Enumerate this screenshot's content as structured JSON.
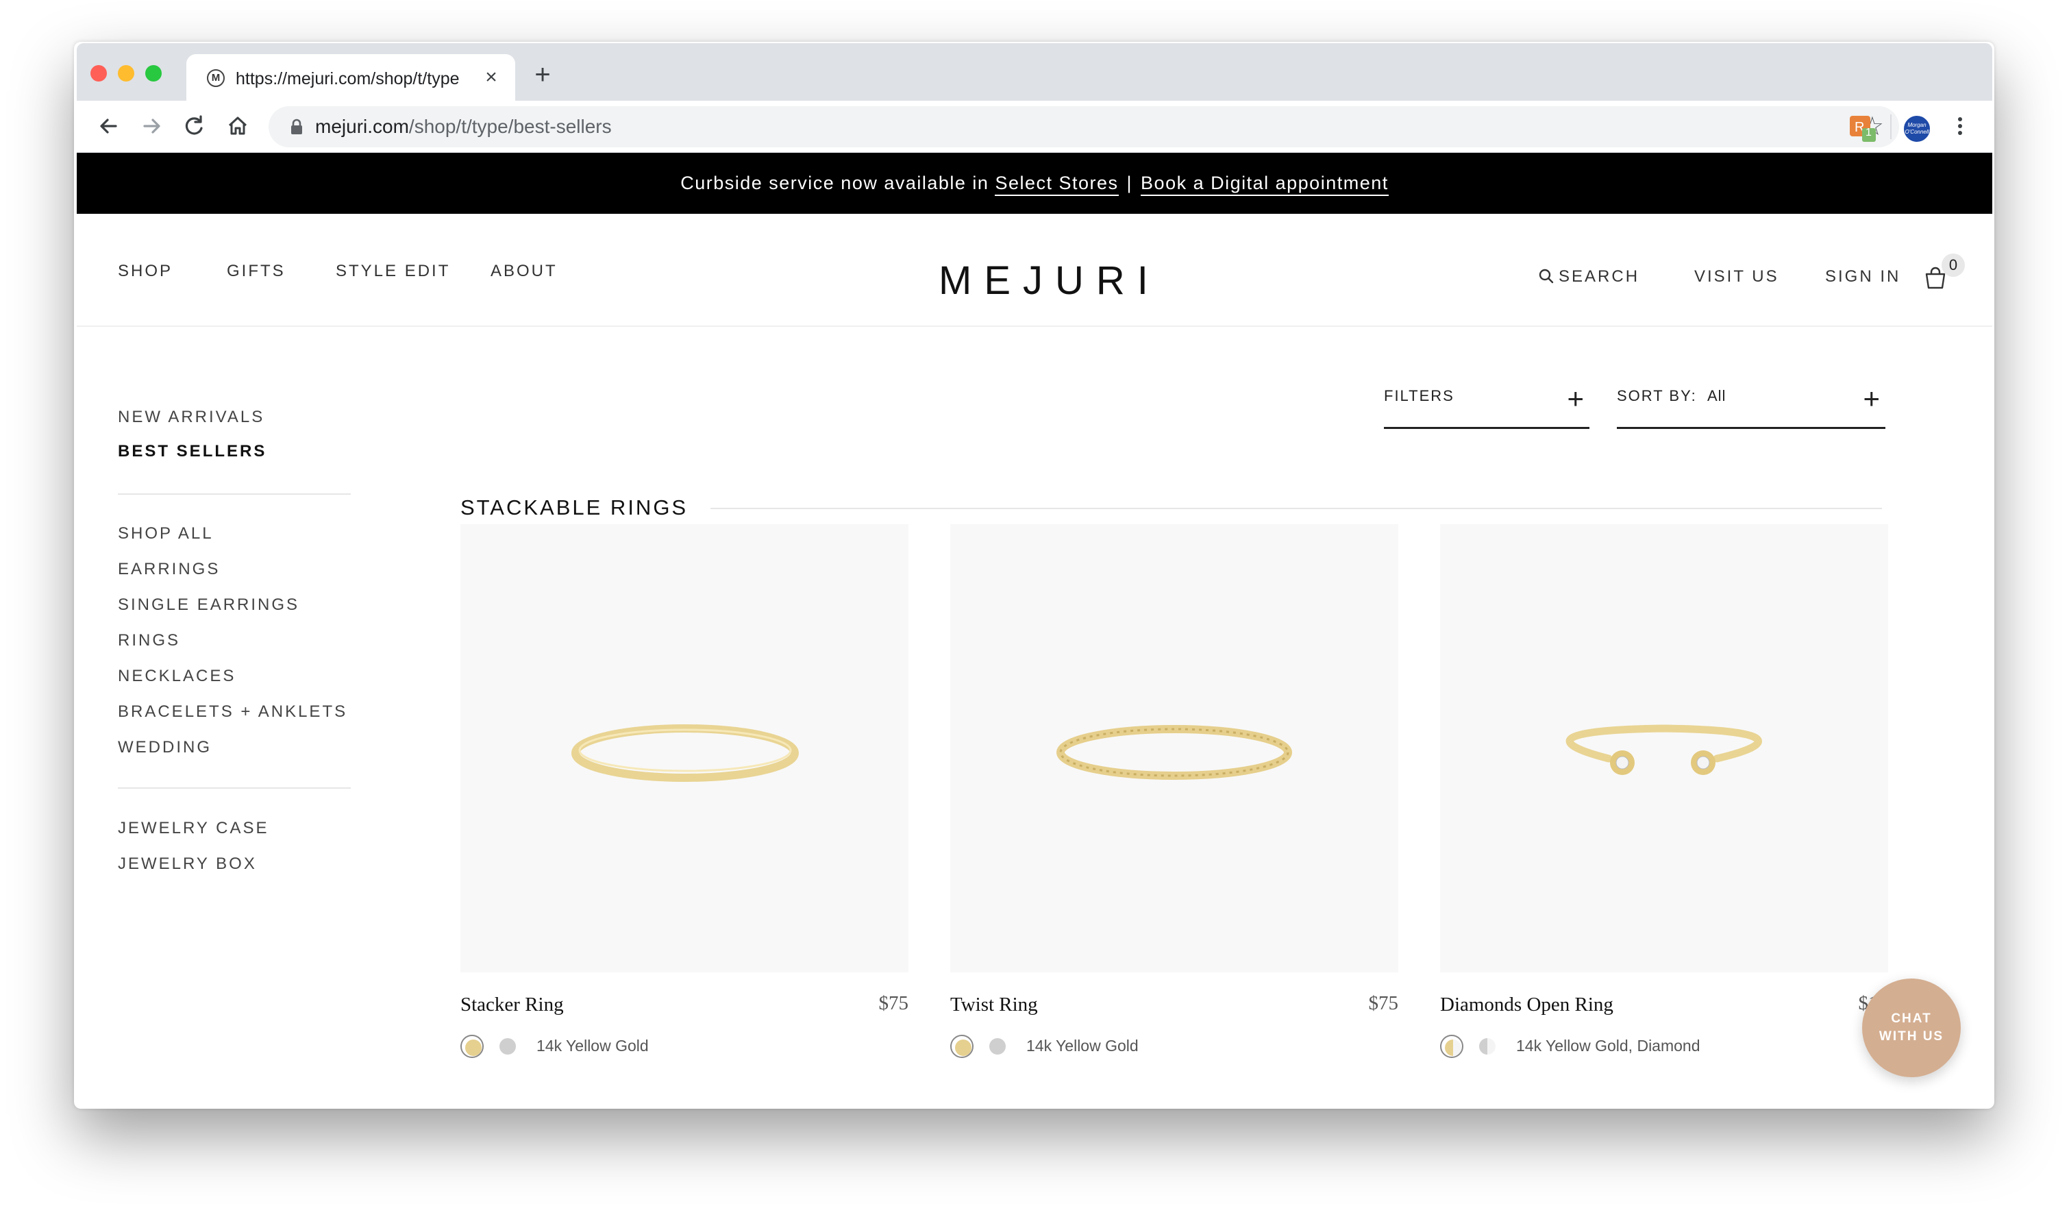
{
  "browser": {
    "tab_title": "https://mejuri.com/shop/t/type",
    "favicon_letter": "M",
    "url_host": "mejuri.com",
    "url_path": "/shop/t/type/best-sellers",
    "extension_badge": "1",
    "profile_label": "Morgan O'Connell"
  },
  "promo": {
    "text": "Curbside service now available in",
    "link1": "Select Stores",
    "separator": "|",
    "link2": "Book a Digital appointment"
  },
  "nav": {
    "left": [
      "SHOP",
      "GIFTS",
      "STYLE EDIT",
      "ABOUT"
    ],
    "logo": "MEJURI",
    "search": "SEARCH",
    "visit": "VISIT US",
    "signin": "SIGN IN",
    "cart_count": "0"
  },
  "filters": {
    "filters_label": "FILTERS",
    "sort_label": "SORT BY:",
    "sort_value": "All",
    "plus": "+"
  },
  "sidebar": {
    "group1": [
      "NEW ARRIVALS",
      "BEST SELLERS"
    ],
    "group2": [
      "SHOP ALL",
      "EARRINGS",
      "SINGLE EARRINGS",
      "RINGS",
      "NECKLACES",
      "BRACELETS + ANKLETS",
      "WEDDING"
    ],
    "group3": [
      "JEWELRY CASE",
      "JEWELRY BOX"
    ],
    "active": "BEST SELLERS"
  },
  "section": {
    "title": "STACKABLE RINGS"
  },
  "products": [
    {
      "name": "Stacker Ring",
      "price": "$75",
      "material": "14k Yellow Gold"
    },
    {
      "name": "Twist Ring",
      "price": "$75",
      "material": "14k Yellow Gold"
    },
    {
      "name": "Diamonds Open Ring",
      "price": "$16",
      "material": "14k Yellow Gold, Diamond"
    }
  ],
  "colors": {
    "gold": "#e6d08f",
    "silver": "#cfcfcf",
    "chat": "#d4ae91"
  },
  "chat": {
    "line1": "CHAT",
    "line2": "WITH US"
  }
}
